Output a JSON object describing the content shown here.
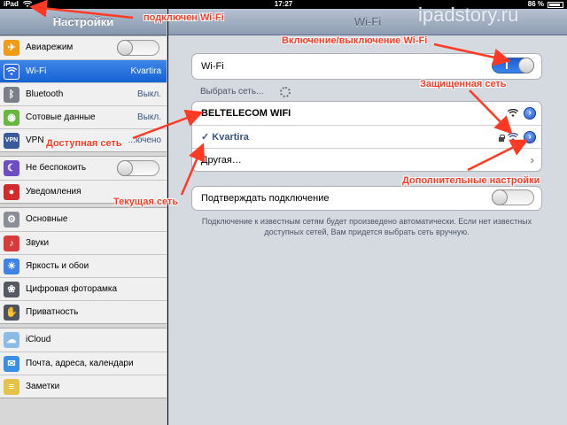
{
  "status_bar": {
    "carrier": "iPad",
    "time": "17:27",
    "battery_percent": "86 %",
    "wifi_icon": "wifi-icon"
  },
  "left_pane": {
    "title": "Настройки",
    "groups": [
      {
        "items": [
          {
            "label": "Авиарежим",
            "icon": "airplane-icon",
            "icon_color": "#f29a16",
            "control": "toggle-off"
          },
          {
            "label": "Wi-Fi",
            "value": "Kvartira",
            "icon": "wifi-icon",
            "icon_color": "#2c6be0",
            "selected": true
          },
          {
            "label": "Bluetooth",
            "value": "Выкл.",
            "icon": "bluetooth-icon",
            "icon_color": "#7a7f88"
          },
          {
            "label": "Сотовые данные",
            "value": "Выкл.",
            "icon": "cellular-icon",
            "icon_color": "#67b63f"
          },
          {
            "label": "VPN",
            "value": "...ючено",
            "icon": "vpn-icon",
            "icon_color": "#3b5a9a"
          }
        ]
      },
      {
        "items": [
          {
            "label": "Не беспокоить",
            "icon": "moon-icon",
            "icon_color": "#6d4cc4",
            "control": "toggle-off"
          },
          {
            "label": "Уведомления",
            "icon": "notifications-icon",
            "icon_color": "#d12b2b"
          }
        ]
      },
      {
        "items": [
          {
            "label": "Основные",
            "icon": "gear-icon",
            "icon_color": "#8a8e96"
          },
          {
            "label": "Звуки",
            "icon": "speaker-icon",
            "icon_color": "#d83b3b"
          },
          {
            "label": "Яркость и обои",
            "icon": "brightness-icon",
            "icon_color": "#3f84e5"
          },
          {
            "label": "Цифровая фоторамка",
            "icon": "photo-frame-icon",
            "icon_color": "#555a62"
          },
          {
            "label": "Приватность",
            "icon": "privacy-hand-icon",
            "icon_color": "#4d5360"
          }
        ]
      },
      {
        "items": [
          {
            "label": "iCloud",
            "icon": "cloud-icon",
            "icon_color": "#8bbce8"
          },
          {
            "label": "Почта, адреса, календари",
            "icon": "mail-icon",
            "icon_color": "#3a8ee6"
          },
          {
            "label": "Заметки",
            "icon": "notes-icon",
            "icon_color": "#e3c34a"
          }
        ]
      }
    ]
  },
  "right_pane": {
    "title": "Wi-Fi",
    "wifi_toggle_label": "Wi-Fi",
    "wifi_toggle_on": true,
    "section_header": "Выбрать сеть...",
    "networks": [
      {
        "name": "BELTELECOM WIFI",
        "secured": false,
        "connected": false,
        "bold": true
      },
      {
        "name": "Kvartira",
        "secured": true,
        "connected": true
      },
      {
        "name": "Другая…",
        "other": true
      }
    ],
    "ask_to_join_label": "Подтверждать подключение",
    "ask_to_join_on": false,
    "footnote": "Подключение к известным сетям будет произведено автоматически. Если нет известных доступных сетей, Вам придется выбрать сеть вручную.",
    "checkmark": "✓"
  },
  "watermark": "ipadstory.ru",
  "annotations": {
    "wifi_connected": "подключен Wi-Fi",
    "wifi_toggle": "Включение/выключение Wi-Fi",
    "secured_network": "Защищенная сеть",
    "available_network": "Доступная сеть",
    "advanced_settings": "Дополнительные настройки",
    "current_network": "Текущая сеть"
  },
  "colors": {
    "annotation": "#ff3a24",
    "selected_row": "#1662d3",
    "toggle_on": "#2f74e6"
  }
}
